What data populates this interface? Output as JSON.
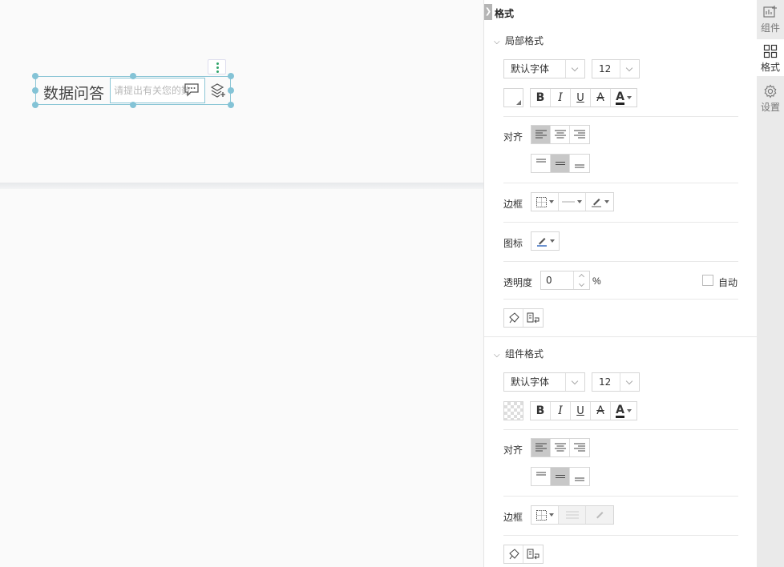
{
  "canvas": {
    "widget": {
      "title": "数据问答",
      "input_placeholder": "请提出有关您的数",
      "accent_color": "#84c3d6"
    }
  },
  "panel": {
    "title": "格式",
    "local_section": {
      "heading": "局部格式",
      "font_family": "默认字体",
      "font_size": "12",
      "align_label": "对齐",
      "border_label": "边框",
      "icon_label": "图标",
      "opacity_label": "透明度",
      "opacity_value": "0",
      "opacity_unit": "%",
      "auto_label": "自动"
    },
    "component_section": {
      "heading": "组件格式",
      "font_family": "默认字体",
      "font_size": "12",
      "align_label": "对齐",
      "border_label": "边框"
    },
    "text_buttons": {
      "bold": "B",
      "italic": "I",
      "underline": "U",
      "strike": "A",
      "font_color": "A"
    }
  },
  "rail": {
    "items": [
      {
        "label": "组件",
        "icon": "add-component-icon"
      },
      {
        "label": "格式",
        "icon": "grid-format-icon"
      },
      {
        "label": "设置",
        "icon": "gear-icon"
      }
    ],
    "active_index": 1
  }
}
